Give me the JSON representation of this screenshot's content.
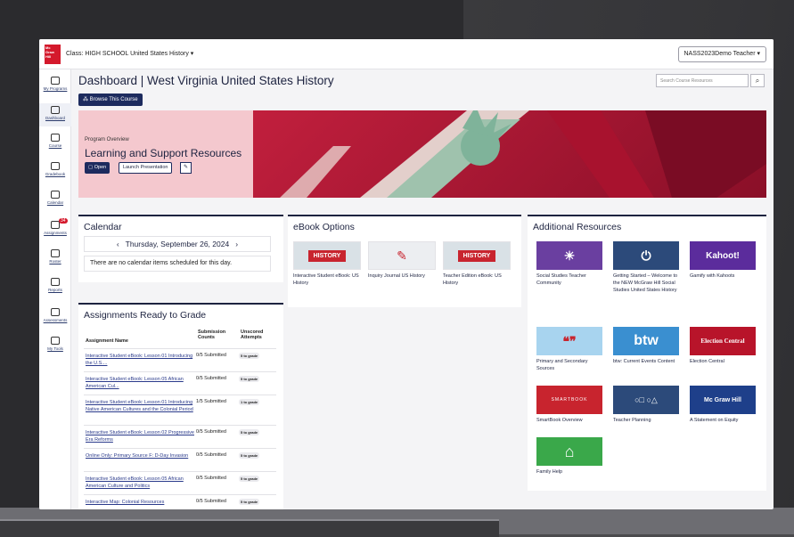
{
  "header": {
    "logo_text": "Mc Graw Hill",
    "class_label": "Class: HIGH SCHOOL United States History ▾",
    "user_label": "NASS2023Demo Teacher ▾"
  },
  "sidebar": {
    "items": [
      {
        "label": "My Programs"
      },
      {
        "label": "Dashboard"
      },
      {
        "label": "Course"
      },
      {
        "label": "Gradebook"
      },
      {
        "label": "Calendar"
      },
      {
        "label": "Assignments",
        "badge": "34"
      },
      {
        "label": "Roster"
      },
      {
        "label": "Reports"
      },
      {
        "label": "Assessments"
      },
      {
        "label": "My Tools"
      }
    ]
  },
  "page": {
    "title": "Dashboard | West Virginia United States History",
    "search_placeholder": "Search Course Resources",
    "browse_button": "Browse This Course"
  },
  "banner": {
    "overview": "Program Overview",
    "title": "Learning and Support Resources",
    "open_button": "Open",
    "launch_button": "Launch Presentation"
  },
  "calendar": {
    "title": "Calendar",
    "date": "Thursday, September 26, 2024",
    "empty_text": "There are no calendar items scheduled for this day."
  },
  "assignments": {
    "title": "Assignments Ready to Grade",
    "headers": [
      "Assignment Name",
      "Submission Counts",
      "Unscored Attempts"
    ],
    "rows": [
      {
        "name": "Interactive Student eBook: Lesson 01 Introducing the U.S....",
        "count": "0/5 Submitted",
        "tag": "5 to grade"
      },
      {
        "name": "Interactive Student eBook: Lesson 05 African American Cul...",
        "count": "0/5 Submitted",
        "tag": "5 to grade"
      },
      {
        "name": "Interactive Student eBook: Lesson 01 Introducing Native American Cultures and the Colonial Period",
        "count": "1/5 Submitted",
        "tag": "1 to grade"
      },
      {
        "name": "Interactive Student eBook: Lesson 02 Progressive Era Reforms",
        "count": "0/5 Submitted",
        "tag": "5 to grade"
      },
      {
        "name": "Online Only: Primary Source F: D-Day Invasion",
        "count": "0/5 Submitted",
        "tag": "5 to grade"
      },
      {
        "name": "Interactive Student eBook: Lesson 05 African American Culture and Politics",
        "count": "0/5 Submitted",
        "tag": "5 to grade"
      },
      {
        "name": "Interactive Map: Colonial Resources",
        "count": "0/5 Submitted",
        "tag": "5 to grade"
      }
    ]
  },
  "ebook": {
    "title": "eBook Options",
    "items": [
      {
        "label": "Interactive Student eBook: US History",
        "cover_text": "HISTORY"
      },
      {
        "label": "Inquiry Journal US History",
        "cover_text": ""
      },
      {
        "label": "Teacher Edition eBook: US History",
        "cover_text": "HISTORY"
      }
    ]
  },
  "resources": {
    "title": "Additional Resources",
    "items": [
      {
        "label": "Social Studies Teacher Community",
        "thumb_text": "",
        "color": "#6a3fa0"
      },
      {
        "label": "Getting Started – Welcome to the NEW McGraw Hill Social Studies United States History",
        "thumb_text": "⏻",
        "color": "#2c4a7a"
      },
      {
        "label": "Gamify with Kahoots",
        "thumb_text": "Kahoot!",
        "color": "#5b2c9c"
      },
      {
        "label": "Primary and Secondary Sources",
        "thumb_text": "❝❞",
        "color": "#a8d4ef"
      },
      {
        "label": "btw: Current Events Content",
        "thumb_text": "btw",
        "color": "#3a8fd0"
      },
      {
        "label": "Election Central",
        "thumb_text": "Election Central",
        "color": "#b8142a"
      },
      {
        "label": "SmartBook Overview",
        "thumb_text": "SMARTBOOK",
        "color": "#c8242e"
      },
      {
        "label": "Teacher Planning",
        "thumb_text": "○□ ○△",
        "color": "#2c4a7a"
      },
      {
        "label": "A Statement on Equity",
        "thumb_text": "Mc Graw Hill",
        "color": "#1e3f8a"
      },
      {
        "label": "Family Help",
        "thumb_text": "⌂",
        "color": "#3aa84a"
      }
    ]
  }
}
